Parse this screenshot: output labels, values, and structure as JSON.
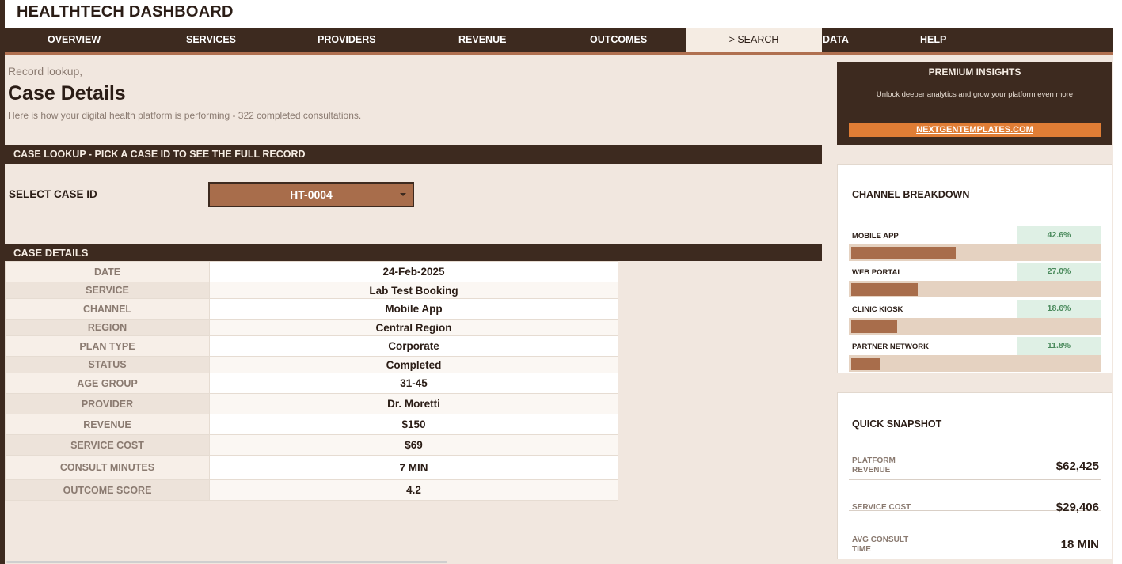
{
  "app": {
    "title": "HEALTHTECH DASHBOARD"
  },
  "nav": {
    "items": [
      {
        "label": "OVERVIEW",
        "active": false
      },
      {
        "label": "SERVICES",
        "active": false
      },
      {
        "label": "PROVIDERS",
        "active": false
      },
      {
        "label": "REVENUE",
        "active": false
      },
      {
        "label": "OUTCOMES",
        "active": false
      },
      {
        "label": "> SEARCH",
        "active": true
      },
      {
        "label": "DATA",
        "active": false
      },
      {
        "label": "HELP",
        "active": false
      }
    ]
  },
  "intro": {
    "small": "Record lookup,",
    "title": "Case Details",
    "subtitle": "Here is how your digital health platform is performing  -  322 completed consultations."
  },
  "lookup": {
    "bar_text": "CASE LOOKUP  -  PICK A CASE ID TO SEE THE FULL RECORD",
    "select_label": "SELECT CASE ID",
    "selected_case": "HT-0004"
  },
  "details": {
    "bar_text": "CASE DETAILS",
    "rows": [
      {
        "key": "DATE",
        "value": "24-Feb-2025"
      },
      {
        "key": "SERVICE",
        "value": "Lab Test Booking"
      },
      {
        "key": "CHANNEL",
        "value": "Mobile App"
      },
      {
        "key": "REGION",
        "value": "Central Region"
      },
      {
        "key": "PLAN TYPE",
        "value": "Corporate"
      },
      {
        "key": "STATUS",
        "value": "Completed"
      },
      {
        "key": "AGE GROUP",
        "value": "31-45"
      },
      {
        "key": "PROVIDER",
        "value": "Dr. Moretti"
      },
      {
        "key": "REVENUE",
        "value": "$150"
      },
      {
        "key": "SERVICE COST",
        "value": "$69"
      },
      {
        "key": "CONSULT MINUTES",
        "value": "7 MIN"
      },
      {
        "key": "OUTCOME SCORE",
        "value": "4.2"
      }
    ]
  },
  "premium": {
    "title": "PREMIUM INSIGHTS",
    "subtitle": "Unlock deeper analytics and grow your platform even more",
    "link": "NEXTGENTEMPLATES.COM"
  },
  "channel_breakdown": {
    "title": "CHANNEL BREAKDOWN",
    "items": [
      {
        "label": "MOBILE APP",
        "pct_text": "42.6%",
        "share": 0.426
      },
      {
        "label": "WEB PORTAL",
        "pct_text": "27.0%",
        "share": 0.27
      },
      {
        "label": "CLINIC KIOSK",
        "pct_text": "18.6%",
        "share": 0.186
      },
      {
        "label": "PARTNER NETWORK",
        "pct_text": "11.8%",
        "share": 0.118
      }
    ]
  },
  "snapshot": {
    "title": "QUICK SNAPSHOT",
    "items": [
      {
        "label": "PLATFORM\nREVENUE",
        "value": "$62,425"
      },
      {
        "label": "SERVICE COST",
        "value": "$29,406"
      },
      {
        "label": "AVG CONSULT\nTIME",
        "value": "18 MIN"
      }
    ]
  },
  "colors": {
    "dark_brown": "#3d2a1f",
    "accent_brown": "#a86d4b",
    "background": "#f1e7df",
    "orange": "#e07d35",
    "pct_green": "#4a8a5c"
  }
}
